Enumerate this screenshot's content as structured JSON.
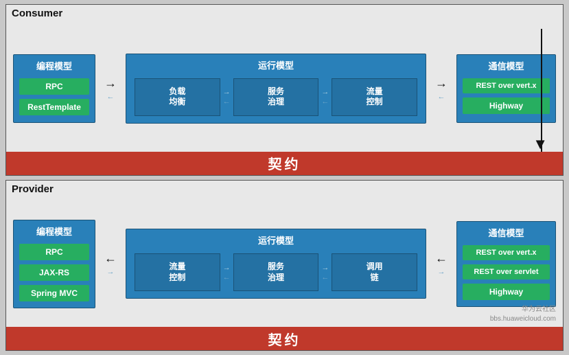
{
  "consumer": {
    "label": "Consumer",
    "prog_model": {
      "title": "编程模型",
      "buttons": [
        "RPC",
        "RestTemplate"
      ]
    },
    "runtime_model": {
      "title": "运行模型",
      "cells": [
        "负载\n均衡",
        "服务\n治理",
        "流量\n控制"
      ]
    },
    "comm_model": {
      "title": "通信模型",
      "buttons": [
        "REST over vert.x",
        "Highway"
      ]
    },
    "contract": "契约"
  },
  "provider": {
    "label": "Provider",
    "prog_model": {
      "title": "编程模型",
      "buttons": [
        "RPC",
        "JAX-RS",
        "Spring MVC"
      ]
    },
    "runtime_model": {
      "title": "运行模型",
      "cells": [
        "流量\n控制",
        "服务\n治理",
        "调用\n链"
      ]
    },
    "comm_model": {
      "title": "通信模型",
      "buttons": [
        "REST over vert.x",
        "REST over servlet",
        "Highway"
      ]
    },
    "contract": "契约"
  },
  "watermark": {
    "line1": "华为云社区",
    "line2": "bbs.huaweicloud.com"
  }
}
